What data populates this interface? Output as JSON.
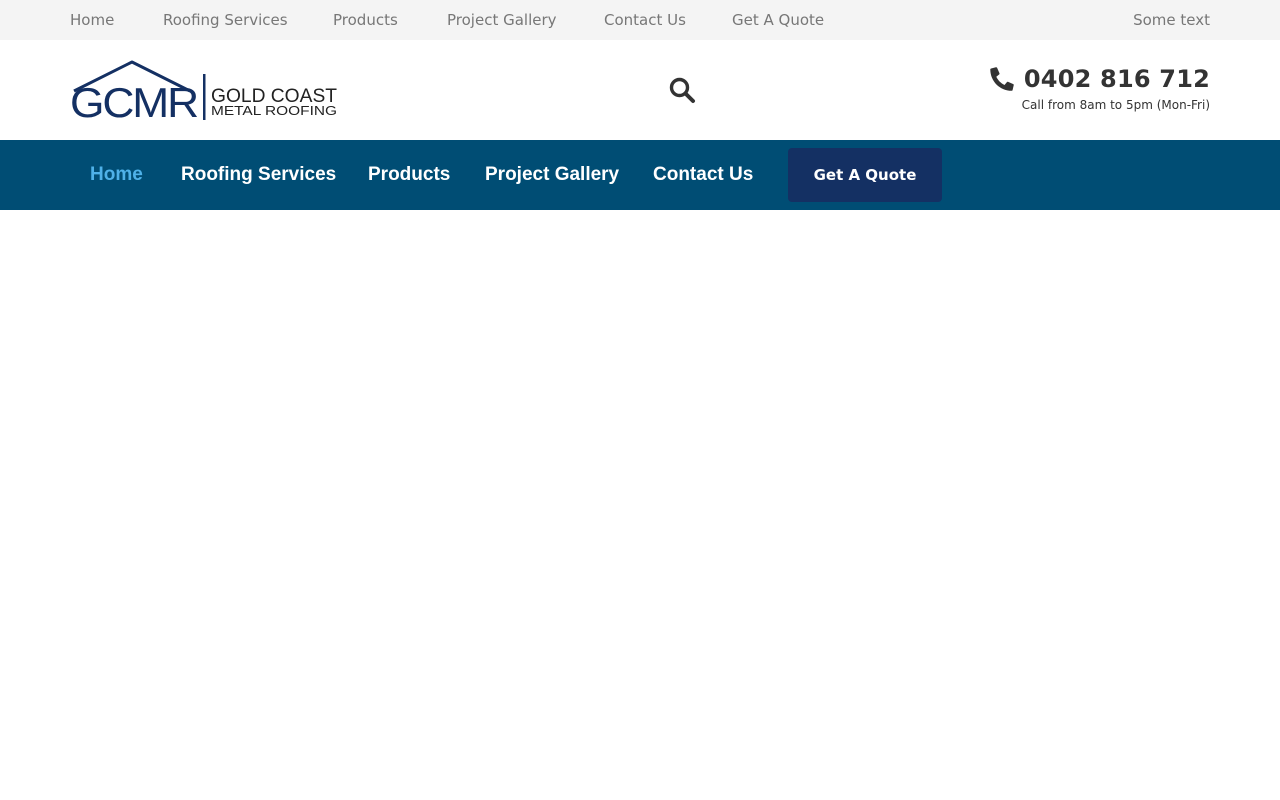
{
  "topbar": {
    "links": [
      {
        "label": "Home"
      },
      {
        "label": "Roofing Services"
      },
      {
        "label": "Products"
      },
      {
        "label": "Project Gallery"
      },
      {
        "label": "Contact Us"
      },
      {
        "label": "Get A Quote"
      }
    ],
    "right_text": "Some text"
  },
  "header": {
    "logo": {
      "monogram": "GCMR",
      "line1": "GOLD COAST",
      "line2": "METAL ROOFING",
      "color": "#143063"
    },
    "search_icon": "search-icon",
    "phone": {
      "icon": "phone-icon",
      "number": "0402 816 712",
      "hours": "Call from 8am to 5pm (Mon-Fri)"
    }
  },
  "nav": {
    "items": [
      {
        "label": "Home",
        "active": true
      },
      {
        "label": "Roofing Services"
      },
      {
        "label": "Products"
      },
      {
        "label": "Project Gallery"
      },
      {
        "label": "Contact Us"
      }
    ],
    "cta": "Get A Quote",
    "background": "#004d74",
    "active_color": "#4fb1e8",
    "cta_color": "#143063"
  }
}
